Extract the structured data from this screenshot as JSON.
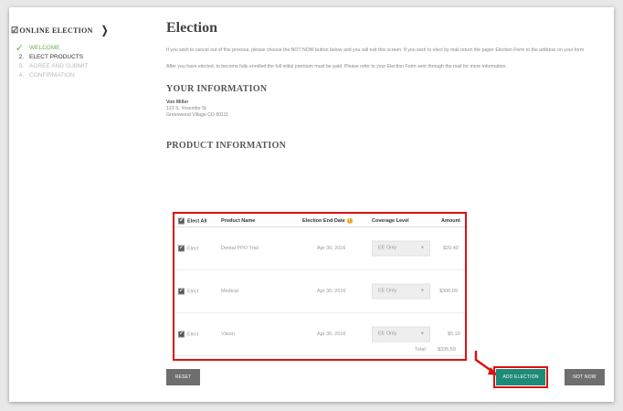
{
  "sidebar": {
    "title": "ONLINE ELECTION",
    "title_check_icon": "check-box-icon",
    "chevron_icon": "chevron-right-icon",
    "steps": [
      {
        "num": "✓",
        "label": "WELCOME",
        "state": "done"
      },
      {
        "num": "2.",
        "label": "ELECT PRODUCTS",
        "state": "active"
      },
      {
        "num": "3.",
        "label": "AGREE AND SUBMIT",
        "state": "todo"
      },
      {
        "num": "4.",
        "label": "CONFIRMATION",
        "state": "todo"
      }
    ]
  },
  "main": {
    "title": "Election",
    "intro": "If you wish to cancel out of this process, please choose the NOT NOW button below and you will exit this screen. If you wish to elect by mail return the paper Election Form to the address on your form",
    "note": "After you have elected, to become fully enrolled the full initial premium must be paid. Please refer to your Election Form sent through the mail for more information.",
    "your_info_heading": "YOUR INFORMATION",
    "person": {
      "name": "Von Miller",
      "street": "123 S. Yosemite St",
      "city": "Greenwood Village CO 80111"
    },
    "product_heading": "PRODUCT INFORMATION"
  },
  "table": {
    "headers": {
      "elect_all": "Elect All",
      "product_name": "Product Name",
      "end_date": "Election End Date",
      "coverage": "Coverage Level",
      "amount": "Amount"
    },
    "rows": [
      {
        "elect": "Elect",
        "product": "Dental PPO Trial",
        "date": "Apr 30, 2016",
        "coverage": "EE Only",
        "amount": "$20.40"
      },
      {
        "elect": "Elect",
        "product": "Medical",
        "date": "Apr 30, 2016",
        "coverage": "EE Only",
        "amount": "$306.09"
      },
      {
        "elect": "Elect",
        "product": "Vision",
        "date": "Apr 30, 2016",
        "coverage": "EE Only",
        "amount": "$5.10"
      }
    ],
    "total_label": "Total:",
    "total_value": "$335.59"
  },
  "buttons": {
    "reset": "RESET",
    "add_election": "ADD ELECTION",
    "not_now": "NOT NOW"
  },
  "colors": {
    "accent_green": "#6ab04c",
    "primary_button": "#1e8a78",
    "highlight_red": "#dd1111",
    "info_orange": "#f0a020"
  }
}
